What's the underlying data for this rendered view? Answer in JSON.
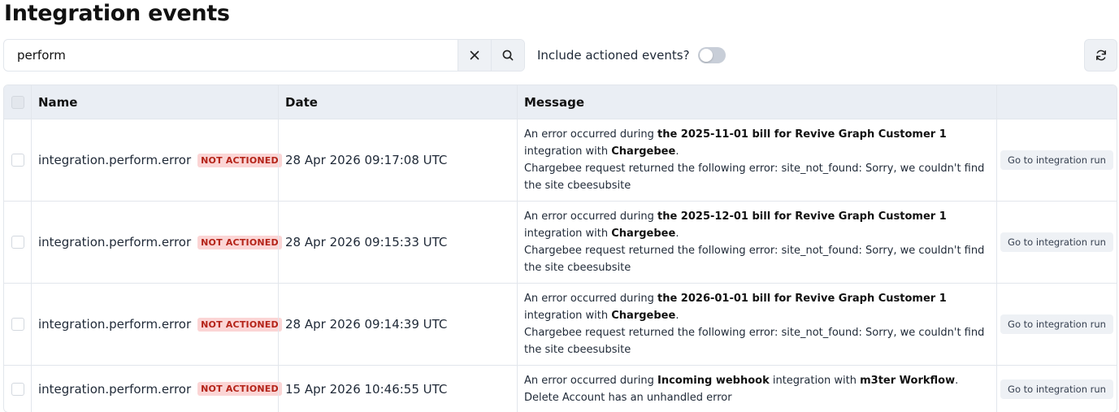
{
  "page": {
    "title": "Integration events"
  },
  "search": {
    "value": "perform"
  },
  "icons": {
    "clear": "close-icon",
    "search": "search-icon",
    "refresh": "refresh-icon"
  },
  "toggle": {
    "label": "Include actioned events?",
    "checked": false
  },
  "table": {
    "headers": {
      "name": "Name",
      "date": "Date",
      "message": "Message"
    },
    "rows": [
      {
        "name": "integration.perform.error",
        "badge": "NOT ACTIONED",
        "date": "28 Apr 2026 09:17:08 UTC",
        "message": {
          "prefix": "An error occurred during ",
          "subject": "the 2025-11-01 bill for Revive Graph Customer 1",
          "middle": " integration with ",
          "integration": "Chargebee",
          "suffix": ".",
          "detail": "Chargebee request returned the following error: site_not_found: Sorry, we couldn't find the site cbeesubsite"
        },
        "action": "Go to integration run"
      },
      {
        "name": "integration.perform.error",
        "badge": "NOT ACTIONED",
        "date": "28 Apr 2026 09:15:33 UTC",
        "message": {
          "prefix": "An error occurred during ",
          "subject": "the 2025-12-01 bill for Revive Graph Customer 1",
          "middle": " integration with ",
          "integration": "Chargebee",
          "suffix": ".",
          "detail": "Chargebee request returned the following error: site_not_found: Sorry, we couldn't find the site cbeesubsite"
        },
        "action": "Go to integration run"
      },
      {
        "name": "integration.perform.error",
        "badge": "NOT ACTIONED",
        "date": "28 Apr 2026 09:14:39 UTC",
        "message": {
          "prefix": "An error occurred during ",
          "subject": "the 2026-01-01 bill for Revive Graph Customer 1",
          "middle": " integration with ",
          "integration": "Chargebee",
          "suffix": ".",
          "detail": "Chargebee request returned the following error: site_not_found: Sorry, we couldn't find the site cbeesubsite"
        },
        "action": "Go to integration run"
      },
      {
        "name": "integration.perform.error",
        "badge": "NOT ACTIONED",
        "date": "15 Apr 2026 10:46:55 UTC",
        "message": {
          "prefix": "An error occurred during ",
          "subject": "Incoming webhook",
          "middle": " integration with ",
          "integration": "m3ter Workflow",
          "suffix": ".",
          "detail": "Delete Account has an unhandled error"
        },
        "action": "Go to integration run"
      }
    ]
  },
  "colors": {
    "badge_bg": "#fbd5d5",
    "badge_text": "#b42318",
    "header_bg": "#eaeef4",
    "toggle_off": "#c8ced8"
  }
}
